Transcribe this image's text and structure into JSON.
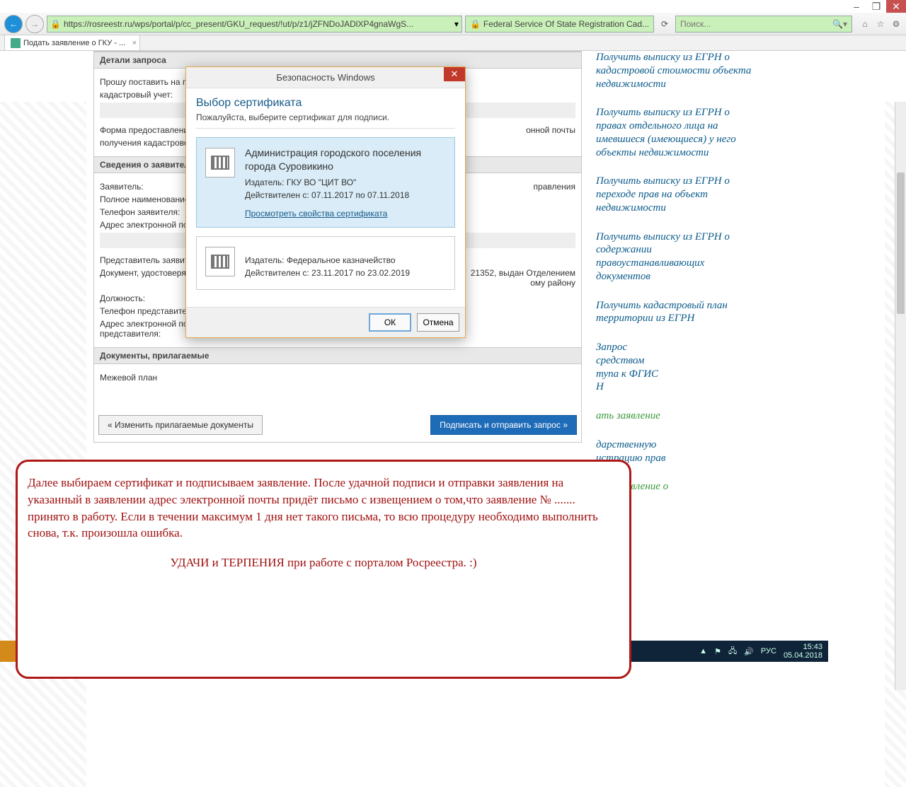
{
  "window": {
    "minimize": "–",
    "restore": "❐",
    "close": "✕"
  },
  "ie": {
    "url": "https://rosreestr.ru/wps/portal/p/cc_present/GKU_request/!ut/p/z1/jZFNDoJADlXP4gnaWgS...",
    "site_label": "Federal Service Of State Registration Cad...",
    "search_placeholder": "Поиск...",
    "tab_title": "Подать заявление о ГКУ - ..."
  },
  "form": {
    "sect_details": "Детали запроса",
    "line1": "Прошу поставить на го",
    "line2": "кадастровый учет:",
    "line3a": "Форма предоставлени",
    "line3b": "получения кадастрово",
    "line3c": "онной почты",
    "sect_app": "Сведения о заявителе",
    "f1": "Заявитель:",
    "f1v": "правления",
    "f2": "Полное наименование",
    "f3": "Телефон заявителя:",
    "f4": "Адрес электронной по",
    "f5": "Представитель заявит",
    "f6": "Документ, удостоверя",
    "f6v": "21352, выдан Отделением\nому району",
    "f7": "Должность:",
    "f8": "Телефон представител",
    "f9": "Адрес электронной по\nпредставителя:",
    "sect_docs": "Документы, прилагаемые",
    "doc1": "Межевой план",
    "btn_back": "« Изменить прилагаемые документы",
    "btn_submit": "Подписать и отправить запрос »"
  },
  "sidebar": [
    "Получить выписку из ЕГРН о кадастровой стоимости объекта недвижимости",
    "Получить выписку из ЕГРН о правах отдельного лица на имевшиеся (имеющиеся) у него объекты недвижимости",
    "Получить выписку из ЕГРН о переходе прав на объект недвижимости",
    "Получить выписку из ЕГРН о содержании правоустанавливающих документов",
    "Получить кадастровый план территории из ЕГРН",
    "Запрос\nсредством\nтупа к ФГИС\nН",
    "ать заявление",
    "дарственную\nистрацию прав",
    "ать заявление о"
  ],
  "dialog": {
    "title": "Безопасность Windows",
    "h": "Выбор сертификата",
    "p": "Пожалуйста, выберите сертификат для подписи.",
    "cert1": {
      "title": "Администрация городского поселения города Суровикино",
      "issuer": "Издатель: ГКУ ВО \"ЦИТ ВО\"",
      "valid": "Действителен с: 07.11.2017 по 07.11.2018",
      "link": "Просмотреть свойства сертификата"
    },
    "cert2": {
      "issuer": "Издатель: Федеральное казначейство",
      "valid": "Действителен с: 23.11.2017 по 23.02.2019"
    },
    "ok": "ОК",
    "cancel": "Отмена"
  },
  "note": {
    "p1": "Далее выбираем сертификат и подписываем заявление.  После удачной подписи и отправки заявления на указанный в заявлении адрес электронной почты  придёт  письмо с извещением о том,что заявление № .......  принято в работу. Если в течении максимум 1 дня нет такого письма, то всю процедуру необходимо выполнить снова, т.к. произошла ошибка.",
    "p2": "УДАЧИ и ТЕРПЕНИЯ при работе с порталом Росреестра. :)"
  },
  "taskbar": {
    "lang": "РУС",
    "time": "15:43",
    "date": "05.04.2018"
  }
}
